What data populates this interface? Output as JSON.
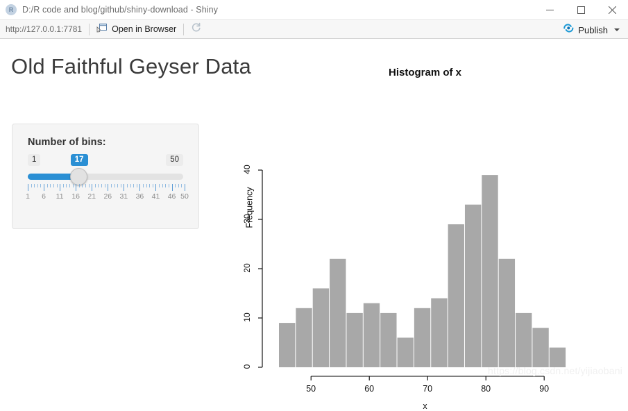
{
  "window": {
    "app_icon": "r-logo-icon",
    "title": "D:/R code and blog/github/shiny-download - Shiny",
    "minimize_label": "minimize-icon",
    "maximize_label": "maximize-icon",
    "close_label": "close-icon"
  },
  "toolbar": {
    "url": "http://127.0.0.1:7781",
    "open_in_browser": "Open in Browser",
    "refresh_icon": "refresh-icon",
    "publish_label": "Publish",
    "publish_icon": "publish-icon"
  },
  "page": {
    "heading": "Old Faithful Geyser Data",
    "watermark": "https://blog.csdn.net/yijiaobani"
  },
  "sidebar": {
    "slider": {
      "label": "Number of bins:",
      "min": 1,
      "max": 50,
      "value": 17,
      "min_label": "1",
      "max_label": "50",
      "value_label": "17",
      "tick_labels": [
        "1",
        "6",
        "11",
        "16",
        "21",
        "26",
        "31",
        "36",
        "41",
        "46",
        "50"
      ],
      "accent_color": "#2a8fd4",
      "track_color": "#e3e3e3"
    }
  },
  "chart_data": {
    "type": "bar",
    "title": "Histogram of x",
    "xlabel": "x",
    "ylabel": "Frequency",
    "bar_color": "#a8a8a8",
    "grid": false,
    "legend": null,
    "xlim": [
      44.5,
      97
    ],
    "ylim": [
      0,
      40
    ],
    "xticks": [
      50,
      60,
      70,
      80,
      90
    ],
    "yticks": [
      0,
      10,
      20,
      30,
      40
    ],
    "bin_width": 2.9,
    "bin_starts": [
      44.5,
      47.4,
      50.3,
      53.2,
      56.1,
      59.0,
      61.9,
      64.8,
      67.7,
      70.6,
      73.5,
      76.4,
      79.3,
      82.2,
      85.1,
      88.0,
      90.9,
      93.8
    ],
    "categories": [
      "44.5-47.4",
      "47.4-50.3",
      "50.3-53.2",
      "53.2-56.1",
      "56.1-59.0",
      "59.0-61.9",
      "61.9-64.8",
      "64.8-67.7",
      "67.7-70.6",
      "70.6-73.5",
      "73.5-76.4",
      "76.4-79.3",
      "79.3-82.2",
      "82.2-85.1",
      "85.1-88.0",
      "88.0-90.9",
      "90.9-93.8",
      "93.8-96.7"
    ],
    "values": [
      9,
      12,
      16,
      22,
      11,
      13,
      11,
      6,
      12,
      14,
      29,
      33,
      39,
      22,
      11,
      8,
      4,
      0
    ]
  }
}
